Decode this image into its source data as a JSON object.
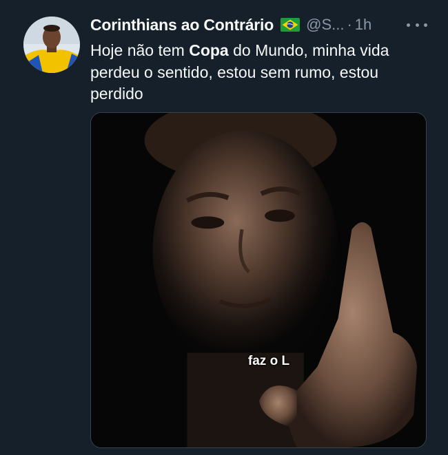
{
  "tweet": {
    "author_name": "Corinthians ao Contrário",
    "author_flag": "brazil-flag-icon",
    "handle": "@S...",
    "separator": "·",
    "time": "1h",
    "text_before": "Hoje não tem ",
    "text_bold": "Copa",
    "text_after": " do Mundo, minha vida perdeu o sentido, estou sem rumo, estou perdido",
    "media": {
      "caption": "faz o L"
    }
  },
  "colors": {
    "background": "#15202b",
    "primary_text": "#f7f9f9",
    "secondary_text": "#8b98a5",
    "border": "#38444d"
  },
  "icons": {
    "more": "more-horizontal-icon",
    "flag": "brazil-flag-icon",
    "avatar": "avatar"
  }
}
